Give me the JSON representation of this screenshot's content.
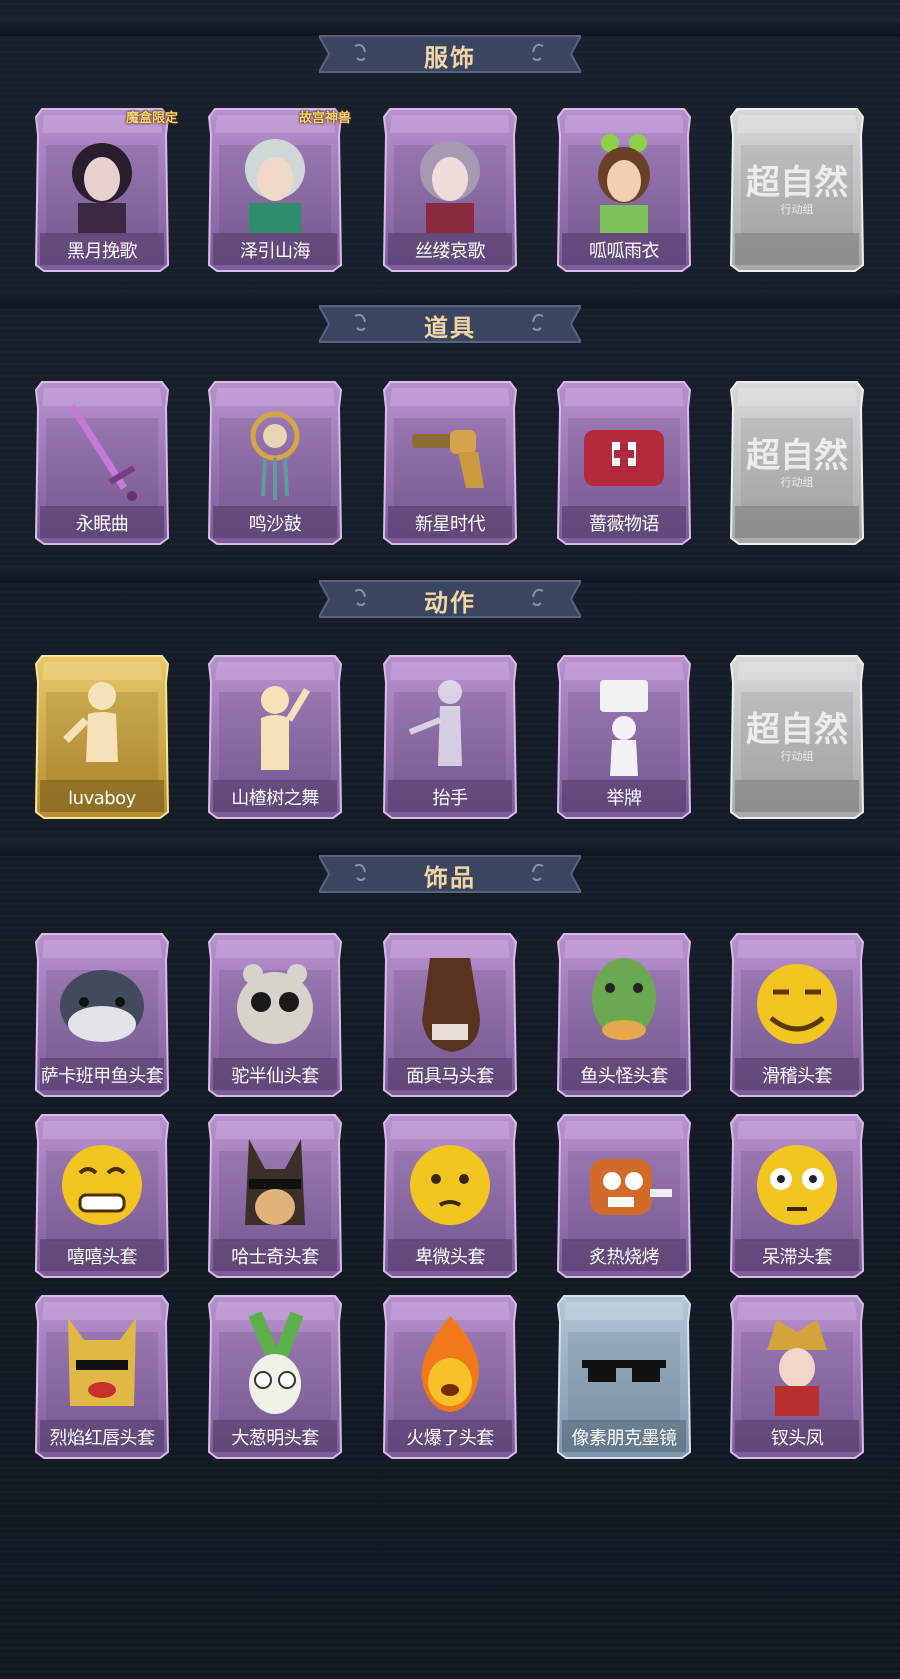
{
  "sections": [
    {
      "title": "服饰",
      "items": [
        {
          "label": "黑月挽歌",
          "badge": "魔盒限定",
          "art": "character-portrait-dark"
        },
        {
          "label": "泽引山海",
          "badge": "故宫神兽",
          "art": "character-portrait-silver"
        },
        {
          "label": "丝缕哀歌",
          "art": "character-portrait-lace"
        },
        {
          "label": "呱呱雨衣",
          "art": "character-portrait-frog"
        }
      ],
      "placeholder": {
        "text": "超自然",
        "sub": "行动组"
      }
    },
    {
      "title": "道具",
      "items": [
        {
          "label": "永眠曲",
          "art": "sword-icon"
        },
        {
          "label": "鸣沙鼓",
          "art": "dreamcatcher-icon"
        },
        {
          "label": "新星时代",
          "art": "revolver-icon"
        },
        {
          "label": "蔷薇物语",
          "art": "medkit-icon"
        }
      ],
      "placeholder": {
        "text": "超自然",
        "sub": "行动组"
      }
    },
    {
      "title": "动作",
      "items": [
        {
          "label": "luvaboy",
          "art": "dance-gesture-icon",
          "rarity": "gold"
        },
        {
          "label": "山楂树之舞",
          "art": "dance-pose-icon"
        },
        {
          "label": "抬手",
          "art": "raise-hand-icon"
        },
        {
          "label": "举牌",
          "art": "hold-sign-icon"
        }
      ],
      "placeholder": {
        "text": "超自然",
        "sub": "行动组"
      }
    },
    {
      "title": "饰品",
      "items": [
        {
          "label": "萨卡班甲鱼头套",
          "art": "fish-head-icon"
        },
        {
          "label": "驼半仙头套",
          "art": "bear-sunglasses-icon"
        },
        {
          "label": "面具马头套",
          "art": "horse-mask-icon"
        },
        {
          "label": "鱼头怪头套",
          "art": "fish-monster-icon"
        },
        {
          "label": "滑稽头套",
          "art": "smirk-emoji-icon"
        },
        {
          "label": "嘻嘻头套",
          "art": "grin-emoji-icon"
        },
        {
          "label": "哈士奇头套",
          "art": "husky-icon"
        },
        {
          "label": "卑微头套",
          "art": "humble-emoji-icon"
        },
        {
          "label": "炙热烧烤",
          "art": "bbq-icon"
        },
        {
          "label": "呆滞头套",
          "art": "dazed-emoji-icon"
        },
        {
          "label": "烈焰红唇头套",
          "art": "yellow-mask-icon"
        },
        {
          "label": "大葱明头套",
          "art": "scallion-icon"
        },
        {
          "label": "火爆了头套",
          "art": "fire-emoji-icon"
        },
        {
          "label": "像素朋克墨镜",
          "art": "pixel-glasses-icon",
          "rarity": "blue"
        },
        {
          "label": "钗头凤",
          "art": "phoenix-crown-icon"
        }
      ]
    }
  ],
  "colors": {
    "purple_frame": "#a07fbc",
    "gold_frame": "#d9b857",
    "silver_frame": "#c8c8c8",
    "blue_frame": "#9bb3c6",
    "title_text": "#f0d6a4",
    "background": "#141b26"
  }
}
